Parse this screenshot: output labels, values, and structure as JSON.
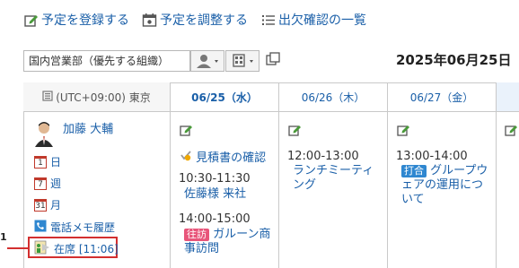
{
  "actions": [
    {
      "label": "予定を登録する",
      "icon": "edit-icon"
    },
    {
      "label": "予定を調整する",
      "icon": "calendar-adjust-icon"
    },
    {
      "label": "出欠確認の一覧",
      "icon": "list-icon"
    }
  ],
  "org": {
    "value": "国内営業部（優先する組織）"
  },
  "current_date": "2025年06月25日",
  "timezone": "(UTC+09:00) 東京",
  "days": [
    {
      "label": "06/25（水）",
      "today": true
    },
    {
      "label": "06/26（木）",
      "today": false
    },
    {
      "label": "06/27（金）",
      "today": false
    }
  ],
  "user": {
    "name": "加藤 大輔",
    "menu": [
      {
        "label": "日",
        "num": "1"
      },
      {
        "label": "週",
        "num": "7"
      },
      {
        "label": "月",
        "num": "31"
      },
      {
        "label": "電話メモ履歴",
        "num": ""
      }
    ],
    "presence": "在席 [11:06]",
    "callout_number": "1"
  },
  "events": {
    "day1": [
      {
        "todo": "見積書の確認"
      },
      {
        "time": "10:30-11:30",
        "title": "佐藤様 来社"
      },
      {
        "time": "14:00-15:00",
        "tag": "往訪",
        "title": "ガルーン商事訪問"
      }
    ],
    "day2": [
      {
        "time": "12:00-13:00",
        "title": "ランチミーティング"
      }
    ],
    "day3": [
      {
        "time": "13:00-14:00",
        "tag": "打合",
        "title": "グループウェアの運用について"
      }
    ]
  },
  "colors": {
    "accent": "#1a5fa8",
    "tag_visit": "#e8557a",
    "tag_meeting": "#2f87d0",
    "callout": "#d32f2f"
  }
}
